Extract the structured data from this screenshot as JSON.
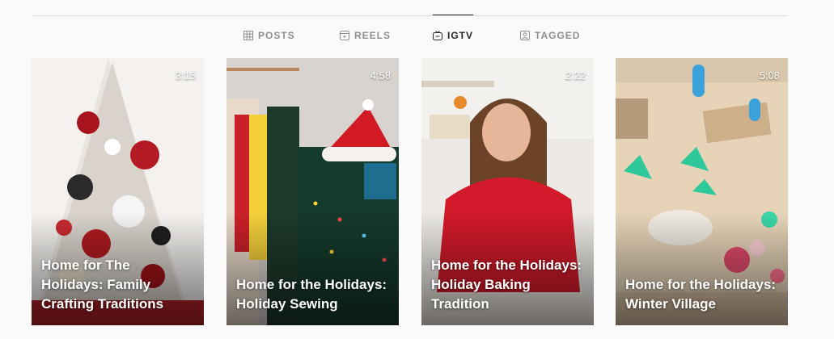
{
  "tabs": [
    {
      "label": "POSTS",
      "icon": "grid-icon",
      "active": false
    },
    {
      "label": "REELS",
      "icon": "reels-icon",
      "active": false
    },
    {
      "label": "IGTV",
      "icon": "igtv-icon",
      "active": true
    },
    {
      "label": "TAGGED",
      "icon": "tagged-icon",
      "active": false
    }
  ],
  "videos": [
    {
      "title": "Home for The Holidays: Family Crafting Traditions",
      "duration": "3:15"
    },
    {
      "title": "Home for the Holidays: Holiday Sewing",
      "duration": "4:58"
    },
    {
      "title": "Home for the Holidays: Holiday Baking Tradition",
      "duration": "2:22"
    },
    {
      "title": "Home for the Holidays: Winter Village",
      "duration": "5:08"
    }
  ]
}
